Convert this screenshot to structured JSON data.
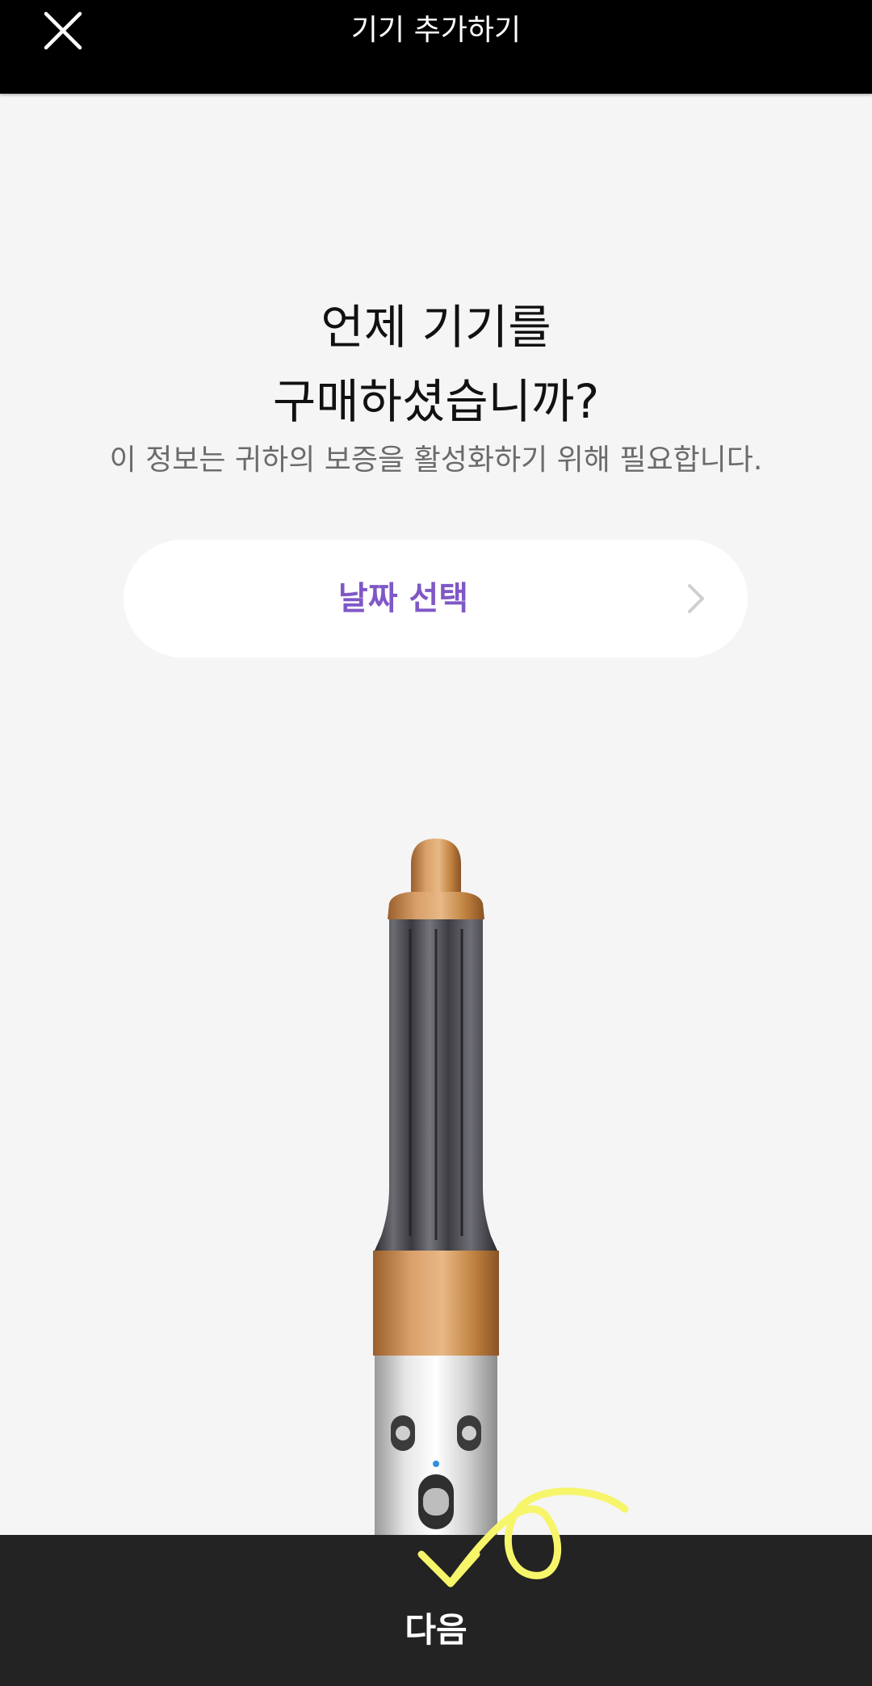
{
  "header": {
    "title": "기기 추가하기",
    "close_icon": "close-icon"
  },
  "main": {
    "question_line1": "언제 기기를",
    "question_line2": "구매하셨습니까?",
    "subtitle": "이 정보는 귀하의 보증을 활성화하기 위해 필요합니다.",
    "date_button_label": "날짜 선택",
    "date_button_icon": "chevron-right-icon"
  },
  "footer": {
    "next_label": "다음"
  },
  "colors": {
    "topbar": "#000000",
    "background": "#f5f5f5",
    "accent": "#7f58c6",
    "bottombar": "#232323",
    "copper": "#c98a4b",
    "annotation": "#f7f56a"
  }
}
